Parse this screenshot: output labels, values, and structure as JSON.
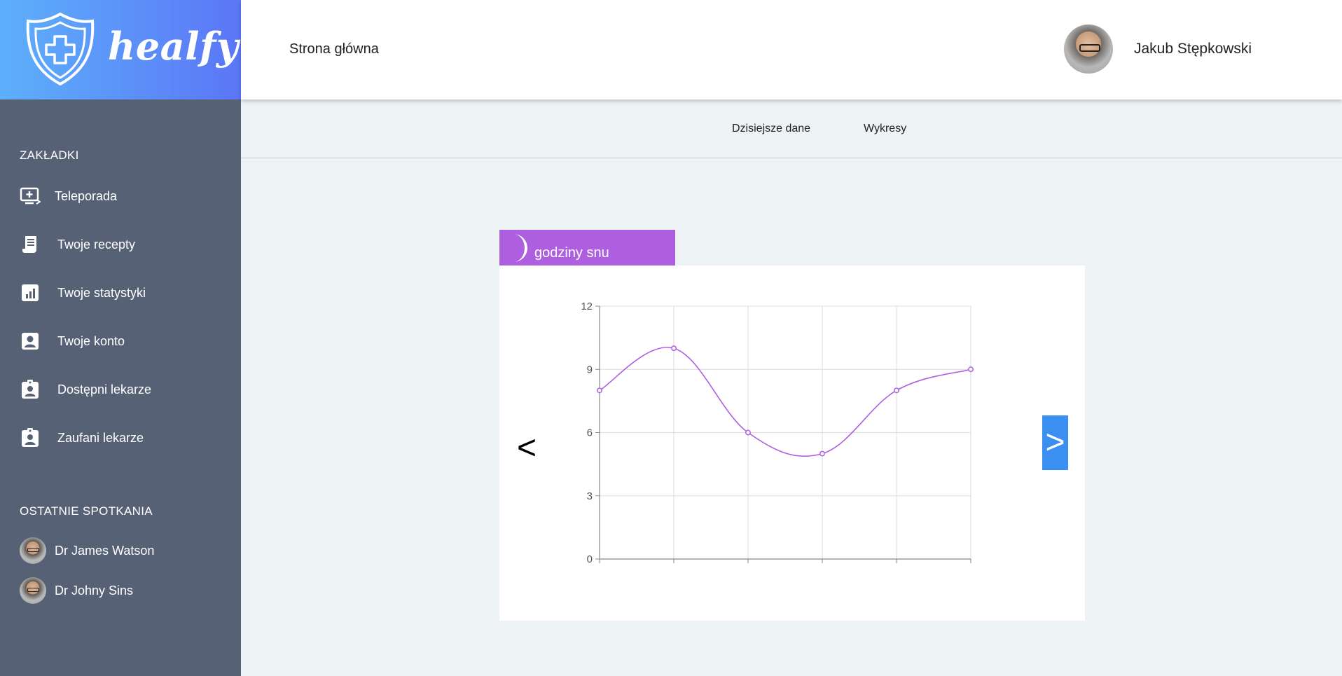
{
  "brand": {
    "name": "healfy",
    "logo_icon": "shield-cross-icon"
  },
  "header": {
    "home_link": "Strona główna",
    "user_name": "Jakub Stępkowski"
  },
  "tabs": [
    {
      "label": "Dzisiejsze dane"
    },
    {
      "label": "Wykresy"
    }
  ],
  "sidebar": {
    "bookmarks_title": "ZAKŁADKI",
    "items": [
      {
        "label": "Teleporada",
        "icon": "monitor-plus-icon"
      },
      {
        "label": "Twoje recepty",
        "icon": "receipt-icon"
      },
      {
        "label": "Twoje statystyki",
        "icon": "bar-chart-icon"
      },
      {
        "label": "Twoje konto",
        "icon": "account-box-icon"
      },
      {
        "label": "Dostępni lekarze",
        "icon": "clipboard-user-icon"
      },
      {
        "label": "Zaufani lekarze",
        "icon": "clipboard-user-icon"
      }
    ],
    "recent_title": "OSTATNIE SPOTKANIA",
    "recent": [
      {
        "label": "Dr James Watson"
      },
      {
        "label": "Dr Johny Sins"
      }
    ]
  },
  "chart_card": {
    "title": "godziny snu",
    "icon": "moon-icon",
    "prev_label": "<",
    "next_label": ">"
  },
  "colors": {
    "accent": "#ad5fe0",
    "sidebar": "#576175",
    "next_button": "#3b8ff0"
  },
  "chart_data": {
    "type": "line",
    "title": "",
    "xlabel": "",
    "ylabel": "",
    "x": [
      1,
      2,
      3,
      4,
      5,
      6
    ],
    "series": [
      {
        "values": [
          8,
          10,
          6,
          5,
          8,
          9
        ]
      }
    ],
    "ylim": [
      0,
      12
    ],
    "yticks": [
      0,
      3,
      6,
      9,
      12
    ],
    "grid": true,
    "line_color": "#ad5fe0"
  }
}
